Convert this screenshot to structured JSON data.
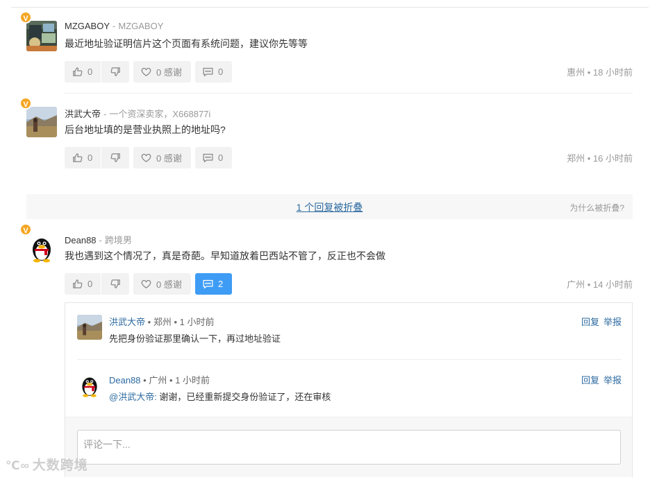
{
  "comments": [
    {
      "name": "MZGABOY",
      "sep": "-",
      "tag": "MZGABOY",
      "badge": "V",
      "text": "最近地址验证明信片这个页面有系统问题，建议你先等等",
      "likes": "0",
      "thanks": "0 感谢",
      "replies": "0",
      "location": "惠州",
      "time": "18 小时前"
    },
    {
      "name": "洪武大帝",
      "sep": "-",
      "tag": "一个资深卖家，X668877i",
      "badge": "V",
      "text": "后台地址填的是营业执照上的地址吗?",
      "likes": "0",
      "thanks": "0 感谢",
      "replies": "0",
      "location": "郑州",
      "time": "16 小时前"
    },
    {
      "name": "Dean88",
      "sep": "-",
      "tag": "跨境男",
      "badge": "V",
      "text": "我也遇到这个情况了，真是奇葩。早知道放着巴西站不管了，反正也不会做",
      "likes": "0",
      "thanks": "0 感谢",
      "replies": "2",
      "location": "广州",
      "time": "14 小时前"
    }
  ],
  "meta_dot": "•",
  "fold": {
    "link": "1 个回复被折叠",
    "why": "为什么被折叠?"
  },
  "replies": [
    {
      "name": "洪武大帝",
      "location": "郑州",
      "time": "1 小时前",
      "mention": "",
      "text": "先把身份验证那里确认一下，再过地址验证",
      "reply_label": "回复",
      "report_label": "举报"
    },
    {
      "name": "Dean88",
      "location": "广州",
      "time": "1 小时前",
      "mention": "@洪武大帝:",
      "text": " 谢谢，已经重新提交身份验证了，还在审核",
      "reply_label": "回复",
      "report_label": "举报"
    }
  ],
  "input": {
    "placeholder": "评论一下..."
  },
  "watermark": "大数跨境",
  "colors": {
    "accent": "#3e9cf5",
    "link": "#2c6aa0",
    "badge": "#f5a623"
  },
  "icons": {
    "like": "thumbs-up-icon",
    "dislike": "thumbs-down-icon",
    "thanks": "heart-icon",
    "reply": "comment-bubble-icon",
    "badge": "verified-badge-icon"
  }
}
